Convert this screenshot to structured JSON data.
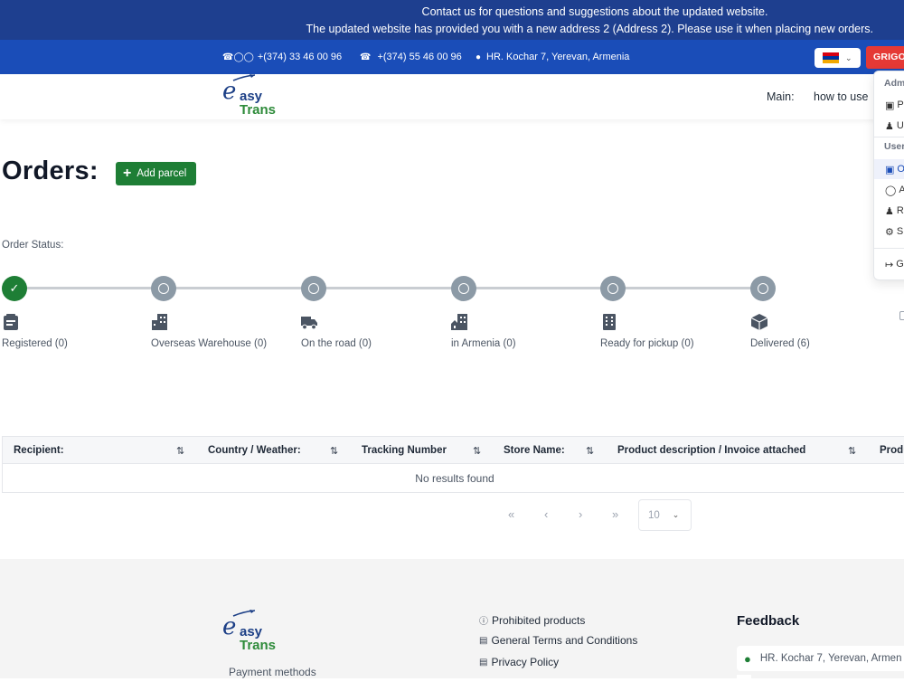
{
  "announcement": {
    "line1": "Contact us for questions and suggestions about the updated website.",
    "line2": "The updated website has provided you with a new address 2 (Address 2). Please use it when placing new orders."
  },
  "contact": {
    "phone1": "+(374) 33 46 00 96",
    "phone2": "+(374) 55 46 00 96",
    "address": "HR. Kochar 7, Yerevan, Armenia"
  },
  "header": {
    "language_flag": "armenia-flag",
    "user_button": "GRIGO",
    "logo_line1": "asy",
    "logo_line2": "Trans",
    "logo_initial": "e",
    "nav": [
      "Main:",
      "how to use"
    ]
  },
  "user_menu": {
    "admin_header": "Adm",
    "admin_items": [
      {
        "icon": "box-icon",
        "label": "P"
      },
      {
        "icon": "users-icon",
        "label": "U"
      }
    ],
    "user_header": "User",
    "user_items": [
      {
        "icon": "box-icon",
        "label": "O",
        "active": true
      },
      {
        "icon": "map-pin-icon",
        "label": "A"
      },
      {
        "icon": "users-icon",
        "label": "R"
      },
      {
        "icon": "gear-icon",
        "label": "S"
      }
    ],
    "logout": {
      "icon": "logout-icon",
      "label": "G"
    }
  },
  "page": {
    "title": "Orders:",
    "add_button": "Add parcel",
    "order_status_label": "Order Status:"
  },
  "status_steps": [
    {
      "label": "Registered (0)",
      "icon": "clipboard-icon",
      "done": true
    },
    {
      "label": "Overseas Warehouse (0)",
      "icon": "building-icon",
      "done": false
    },
    {
      "label": "On the road (0)",
      "icon": "truck-icon",
      "done": false
    },
    {
      "label": "in Armenia (0)",
      "icon": "home-building-icon",
      "done": false
    },
    {
      "label": "Ready for pickup (0)",
      "icon": "office-building-icon",
      "done": false
    },
    {
      "label": "Delivered (6)",
      "icon": "package-icon",
      "done": false
    }
  ],
  "table": {
    "columns": [
      "Recipient:",
      "Country / Weather:",
      "Tracking Number",
      "Store Name:",
      "Product description / Invoice attached",
      "Produ"
    ],
    "empty_message": "No results found"
  },
  "pagination": {
    "first": "«",
    "prev": "‹",
    "next": "›",
    "last": "»",
    "per_page": "10"
  },
  "footer": {
    "logo_line1": "asy",
    "logo_line2": "Trans",
    "logo_initial": "e",
    "payment_methods": "Payment methods",
    "links": [
      "Prohibited products",
      "General Terms and Conditions",
      "Privacy Policy"
    ],
    "feedback_title": "Feedback",
    "feedback_address": "HR. Kochar 7, Yerevan, Armen"
  },
  "colors": {
    "announce_bg": "#1e3f8f",
    "contact_bg": "#1a4db8",
    "primary_green": "#1e7e35",
    "user_red": "#e53935",
    "step_gray": "#8c9aa6"
  }
}
